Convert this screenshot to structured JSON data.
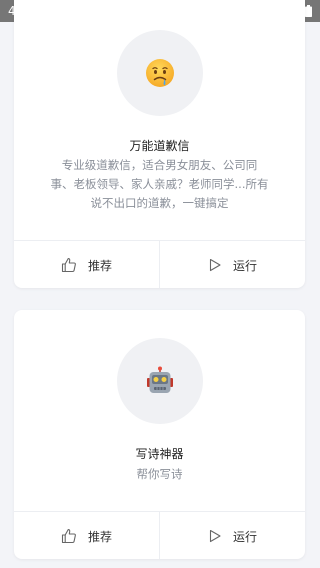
{
  "status_bar": {
    "time": "4:21"
  },
  "cards": [
    {
      "icon": "worried-face-emoji-icon",
      "emoji": "🤤",
      "title": "万能道歉信",
      "description_lines": [
        "专业级道歉信，适合男女朋友、公司同",
        "事、老板领导、家人亲戚？老师同学...所有",
        "说不出口的道歉，一键搞定"
      ],
      "recommend_label": "推荐",
      "run_label": "运行"
    },
    {
      "icon": "robot-emoji-icon",
      "emoji": "🤖",
      "title": "写诗神器",
      "description_lines": [
        "帮你写诗"
      ],
      "recommend_label": "推荐",
      "run_label": "运行"
    }
  ],
  "colors": {
    "background": "#f3f4f8",
    "status_bar": "#767676",
    "card": "#ffffff",
    "muted_text": "#8a8f99"
  }
}
